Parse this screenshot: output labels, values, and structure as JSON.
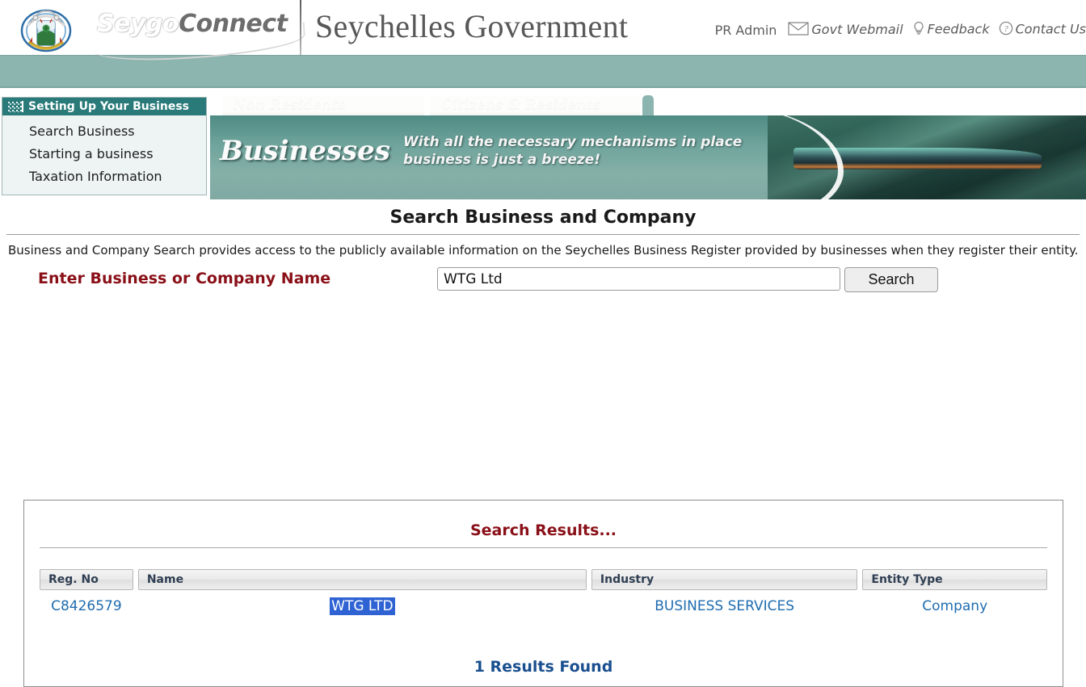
{
  "header": {
    "brand_light": "Seygo",
    "brand_dark": "Connect",
    "gov_title": "Seychelles Government",
    "user_label": "PR Admin",
    "links": [
      {
        "label": "Govt Webmail",
        "icon": "envelope-icon"
      },
      {
        "label": "Feedback",
        "icon": "lightbulb-icon"
      },
      {
        "label": "Contact Us",
        "icon": "question-circle-icon"
      }
    ],
    "crest_icon": "seychelles-coat-of-arms"
  },
  "sidebar": {
    "title": "Setting Up Your Business",
    "items": [
      {
        "label": "Search Business"
      },
      {
        "label": "Starting a business"
      },
      {
        "label": "Taxation Information"
      }
    ]
  },
  "banner": {
    "tabs": [
      {
        "label": "Non Residents"
      },
      {
        "label": "Citizens & Residents"
      }
    ],
    "heading": "Businesses",
    "subtitle_line1": "With all the necessary mechanisms in place",
    "subtitle_line2": "business is just a breeze!",
    "photo_alt": "harbour-ship-photo"
  },
  "main": {
    "page_title": "Search Business and Company",
    "intro": "Business and Company Search provides access to the publicly available information on the Seychelles Business Register provided by businesses when they register their entity.",
    "search_label": "Enter Business or Company Name",
    "search_value": "WTG Ltd",
    "search_placeholder": "",
    "search_button": "Search"
  },
  "results": {
    "title": "Search Results...",
    "columns": [
      "Reg. No",
      "Name",
      "Industry",
      "Entity Type"
    ],
    "rows": [
      {
        "reg_no": "C8426579",
        "name": "WTG LTD",
        "industry": "BUSINESS SERVICES",
        "entity_type": "Company",
        "name_selected": true
      }
    ],
    "count_text": "1 Results Found"
  },
  "colors": {
    "teal_bar": "#8db5af",
    "menu_title": "#2a7a7a",
    "accent_red": "#8a1018",
    "link_blue": "#1f6cb0",
    "selection_blue": "#2f63d4",
    "count_blue": "#1a4f8f"
  }
}
